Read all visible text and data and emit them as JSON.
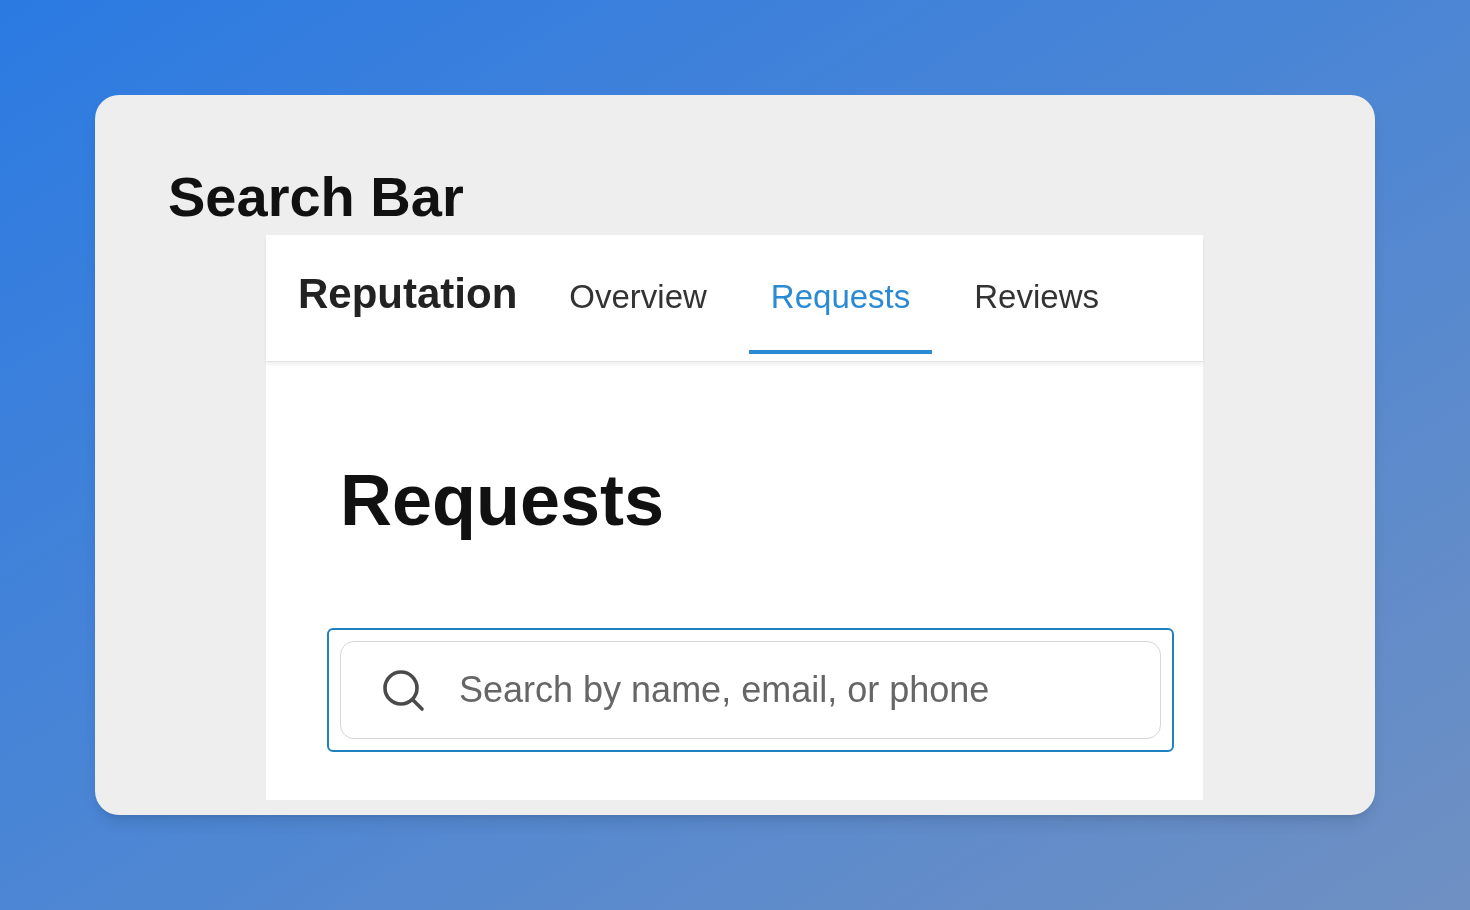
{
  "title": "Search Bar",
  "header": {
    "brand": "Reputation",
    "tabs": [
      {
        "label": "Overview",
        "selected": false
      },
      {
        "label": "Requests",
        "selected": true
      },
      {
        "label": "Reviews",
        "selected": false
      }
    ]
  },
  "heading": "Requests",
  "search": {
    "placeholder": "Search by name, email, or phone"
  }
}
